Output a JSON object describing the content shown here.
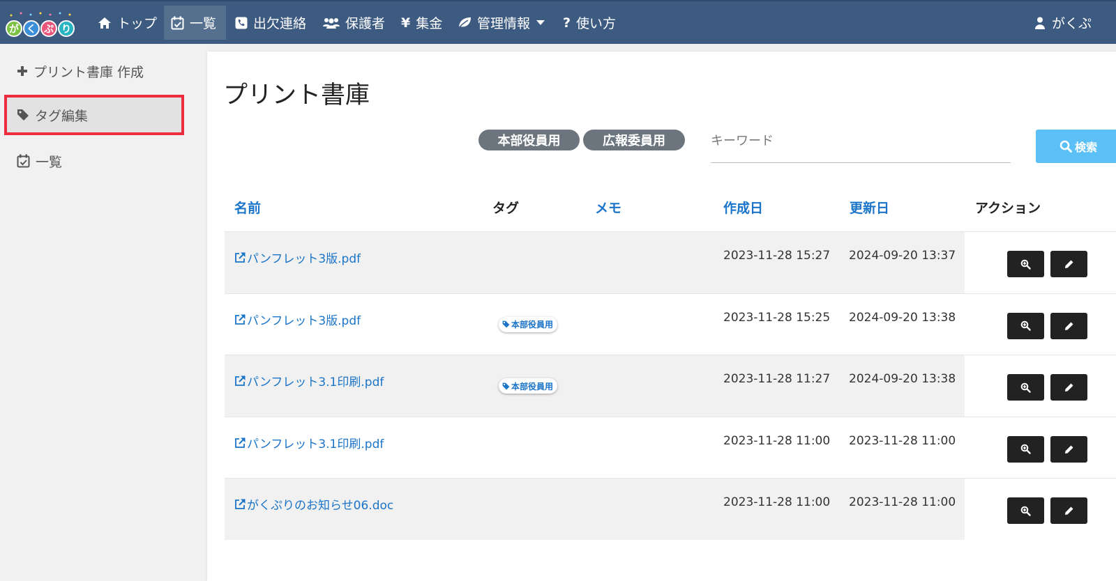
{
  "brand": {
    "logo_text": "がくぷり",
    "letters": [
      "が",
      "く",
      "ぷ",
      "り"
    ],
    "letter_colors": [
      "#7cc242",
      "#3b8fd9",
      "#e9557a",
      "#27b3c2"
    ]
  },
  "nav": {
    "items": [
      {
        "label": "トップ",
        "icon": "home-icon"
      },
      {
        "label": "一覧",
        "icon": "calendar-check-icon",
        "active": true
      },
      {
        "label": "出欠連絡",
        "icon": "phone-icon"
      },
      {
        "label": "保護者",
        "icon": "users-icon"
      },
      {
        "label": "集金",
        "icon": "yen-icon"
      },
      {
        "label": "管理情報",
        "icon": "leaf-icon",
        "dropdown": true
      },
      {
        "label": "使い方",
        "icon": "question-icon"
      }
    ],
    "user_label": "がくぷ"
  },
  "sidebar": {
    "items": [
      {
        "label": "プリント書庫 作成",
        "icon": "plus-icon"
      },
      {
        "label": "タグ編集",
        "icon": "tag-icon",
        "selected": true
      },
      {
        "label": "一覧",
        "icon": "calendar-check-icon"
      }
    ]
  },
  "main": {
    "title": "プリント書庫",
    "tag_filters": [
      "本部役員用",
      "広報委員用"
    ],
    "search": {
      "placeholder": "キーワード",
      "button_label": "検索"
    },
    "table": {
      "headers": {
        "name": "名前",
        "tag": "タグ",
        "memo": "メモ",
        "created": "作成日",
        "updated": "更新日",
        "action": "アクション"
      },
      "rows": [
        {
          "name": "パンフレット3版.pdf",
          "tag": "",
          "memo": "",
          "created": "2023-11-28 15:27",
          "updated": "2024-09-20 13:37"
        },
        {
          "name": "パンフレット3版.pdf",
          "tag": "本部役員用",
          "memo": "",
          "created": "2023-11-28 15:25",
          "updated": "2024-09-20 13:38"
        },
        {
          "name": "パンフレット3.1印刷.pdf",
          "tag": "本部役員用",
          "memo": "",
          "created": "2023-11-28 11:27",
          "updated": "2024-09-20 13:38"
        },
        {
          "name": "パンフレット3.1印刷.pdf",
          "tag": "",
          "memo": "",
          "created": "2023-11-28 11:00",
          "updated": "2023-11-28 11:00"
        },
        {
          "name": "がくぷりのお知らせ06.doc",
          "tag": "",
          "memo": "",
          "created": "2023-11-28 11:00",
          "updated": "2023-11-28 11:00"
        }
      ]
    }
  },
  "colors": {
    "navbar": "#3d5a80",
    "link": "#1a74c8",
    "highlight_border": "#ee2b3f",
    "search_button": "#5bc0f5",
    "tag_filter": "#6c757d",
    "action_button": "#222222"
  }
}
